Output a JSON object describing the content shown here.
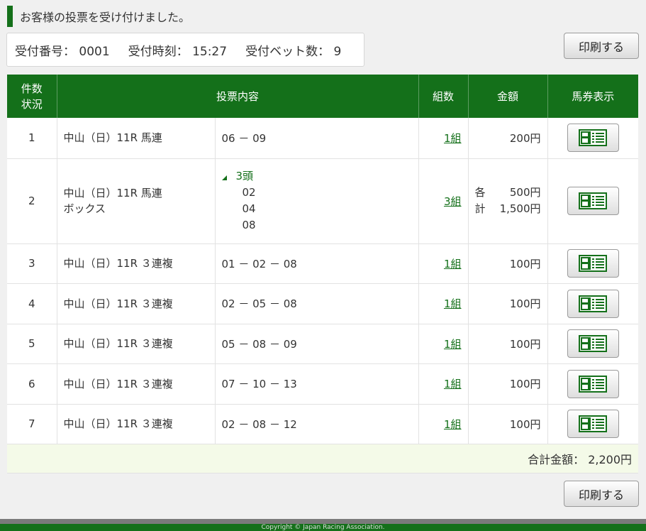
{
  "header": {
    "message": "お客様の投票を受け付けました。"
  },
  "receipt": {
    "number": "受付番号： 0001",
    "time": "受付時刻： 15:27",
    "bet_count": "受付ベット数： 9"
  },
  "buttons": {
    "print_label": "印刷する"
  },
  "table": {
    "headers": {
      "no_line1": "件数",
      "no_line2": "状況",
      "content": "投票内容",
      "kumi": "組数",
      "amount": "金額",
      "view": "馬券表示"
    },
    "rows": [
      {
        "no": "1",
        "race": "中山（日）11R 馬連",
        "selection": "06 － 09",
        "kumi": "1組",
        "amount": "200円"
      },
      {
        "no": "2",
        "race_line1": "中山（日）11R 馬連",
        "race_line2": "ボックス",
        "box_head": "3頭",
        "horses": [
          "02",
          "04",
          "08"
        ],
        "kumi": "3組",
        "amount_each_label": "各",
        "amount_each": "500円",
        "amount_total_label": "計",
        "amount_total": "1,500円"
      },
      {
        "no": "3",
        "race": "中山（日）11R ３連複",
        "selection": "01 － 02 － 08",
        "kumi": "1組",
        "amount": "100円"
      },
      {
        "no": "4",
        "race": "中山（日）11R ３連複",
        "selection": "02 － 05 － 08",
        "kumi": "1組",
        "amount": "100円"
      },
      {
        "no": "5",
        "race": "中山（日）11R ３連複",
        "selection": "05 － 08 － 09",
        "kumi": "1組",
        "amount": "100円"
      },
      {
        "no": "6",
        "race": "中山（日）11R ３連複",
        "selection": "07 － 10 － 13",
        "kumi": "1組",
        "amount": "100円"
      },
      {
        "no": "7",
        "race": "中山（日）11R ３連複",
        "selection": "02 － 08 － 12",
        "kumi": "1組",
        "amount": "100円"
      }
    ],
    "total": "合計金額： 2,200円"
  },
  "footer": {
    "copyright": "Copyright © Japan Racing Association."
  },
  "colors": {
    "accent": "#14701a",
    "total_bg": "#f4fae8"
  },
  "icons": {
    "view": "ticket-view-icon",
    "expand": "triangle-expand-icon"
  }
}
